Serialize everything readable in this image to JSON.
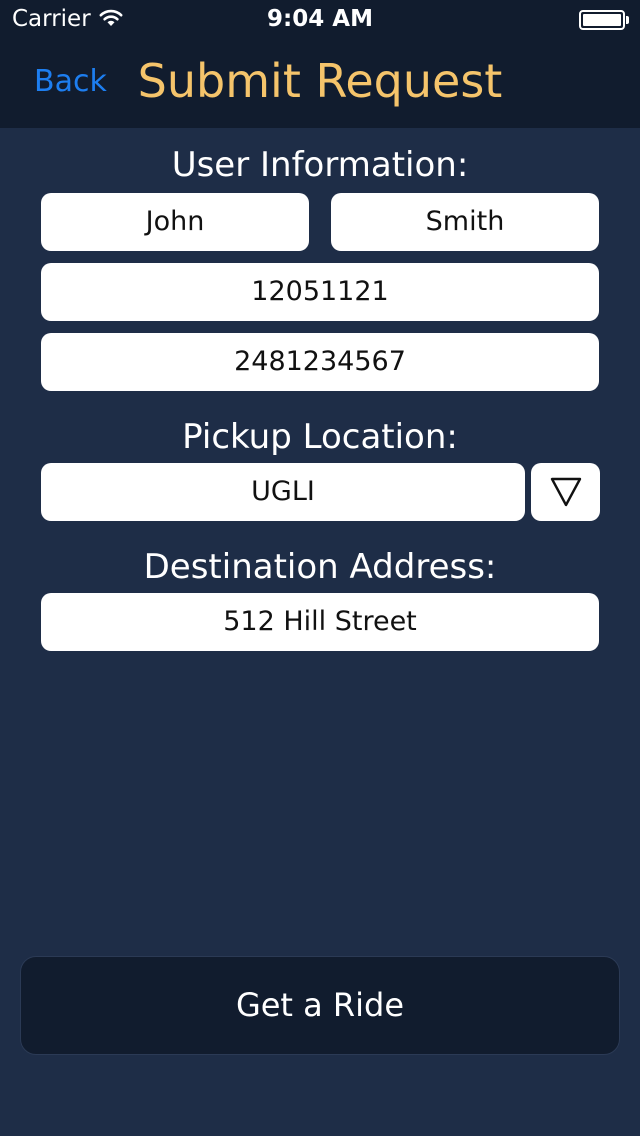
{
  "status_bar": {
    "carrier": "Carrier",
    "time": "9:04 AM"
  },
  "nav": {
    "back_label": "Back",
    "title": "Submit Request"
  },
  "user_info": {
    "heading": "User Information:",
    "first_name": "John",
    "last_name": "Smith",
    "id_number": "12051121",
    "phone": "2481234567"
  },
  "pickup": {
    "heading": "Pickup Location:",
    "value": "UGLI"
  },
  "destination": {
    "heading": "Destination Address:",
    "value": "512 Hill Street"
  },
  "action": {
    "ride_label": "Get a Ride"
  },
  "colors": {
    "background": "#1e2d47",
    "bar": "#111c2e",
    "title": "#f5c46b",
    "link": "#1d7ef0"
  },
  "icons": {
    "wifi": "wifi-icon",
    "battery": "battery-icon",
    "dropdown": "triangle-down-icon"
  }
}
